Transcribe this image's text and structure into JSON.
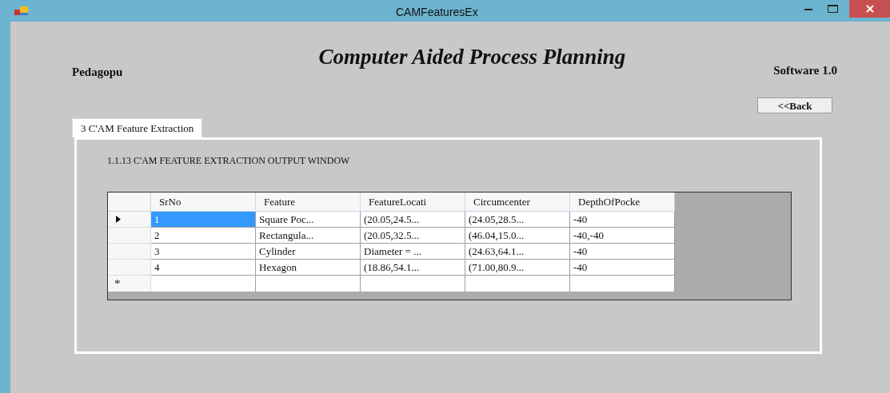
{
  "window": {
    "title": "CAMFeaturesEx"
  },
  "header": {
    "left": "Pedagopu",
    "title": "Computer Aided Process Planning",
    "right": "Software 1.0"
  },
  "back_button": "<<Back",
  "tabs": [
    {
      "label": "3 C'AM Feature Extraction",
      "selected": true
    }
  ],
  "panel_title": "1.1.13 C'AM FEATURE EXTRACTION OUTPUT WINDOW",
  "table": {
    "columns": [
      "SrNo",
      "Feature",
      "FeatureLocati",
      "Circumcenter",
      "DepthOfPocke"
    ],
    "rows": [
      {
        "selected": true,
        "cells": [
          "1",
          "Square Poc...",
          "(20.05,24.5...",
          "(24.05,28.5...",
          "-40"
        ]
      },
      {
        "selected": false,
        "cells": [
          "2",
          "Rectangula...",
          "(20.05,32.5...",
          "(46.04,15.0...",
          "-40,-40"
        ]
      },
      {
        "selected": false,
        "cells": [
          "3",
          "Cylinder",
          "Diameter = ...",
          "(24.63,64.1...",
          "-40"
        ]
      },
      {
        "selected": false,
        "cells": [
          "4",
          "Hexagon",
          "(18.86,54.1...",
          "(71.00,80.9...",
          "-40"
        ]
      }
    ],
    "new_row_marker": "*"
  }
}
